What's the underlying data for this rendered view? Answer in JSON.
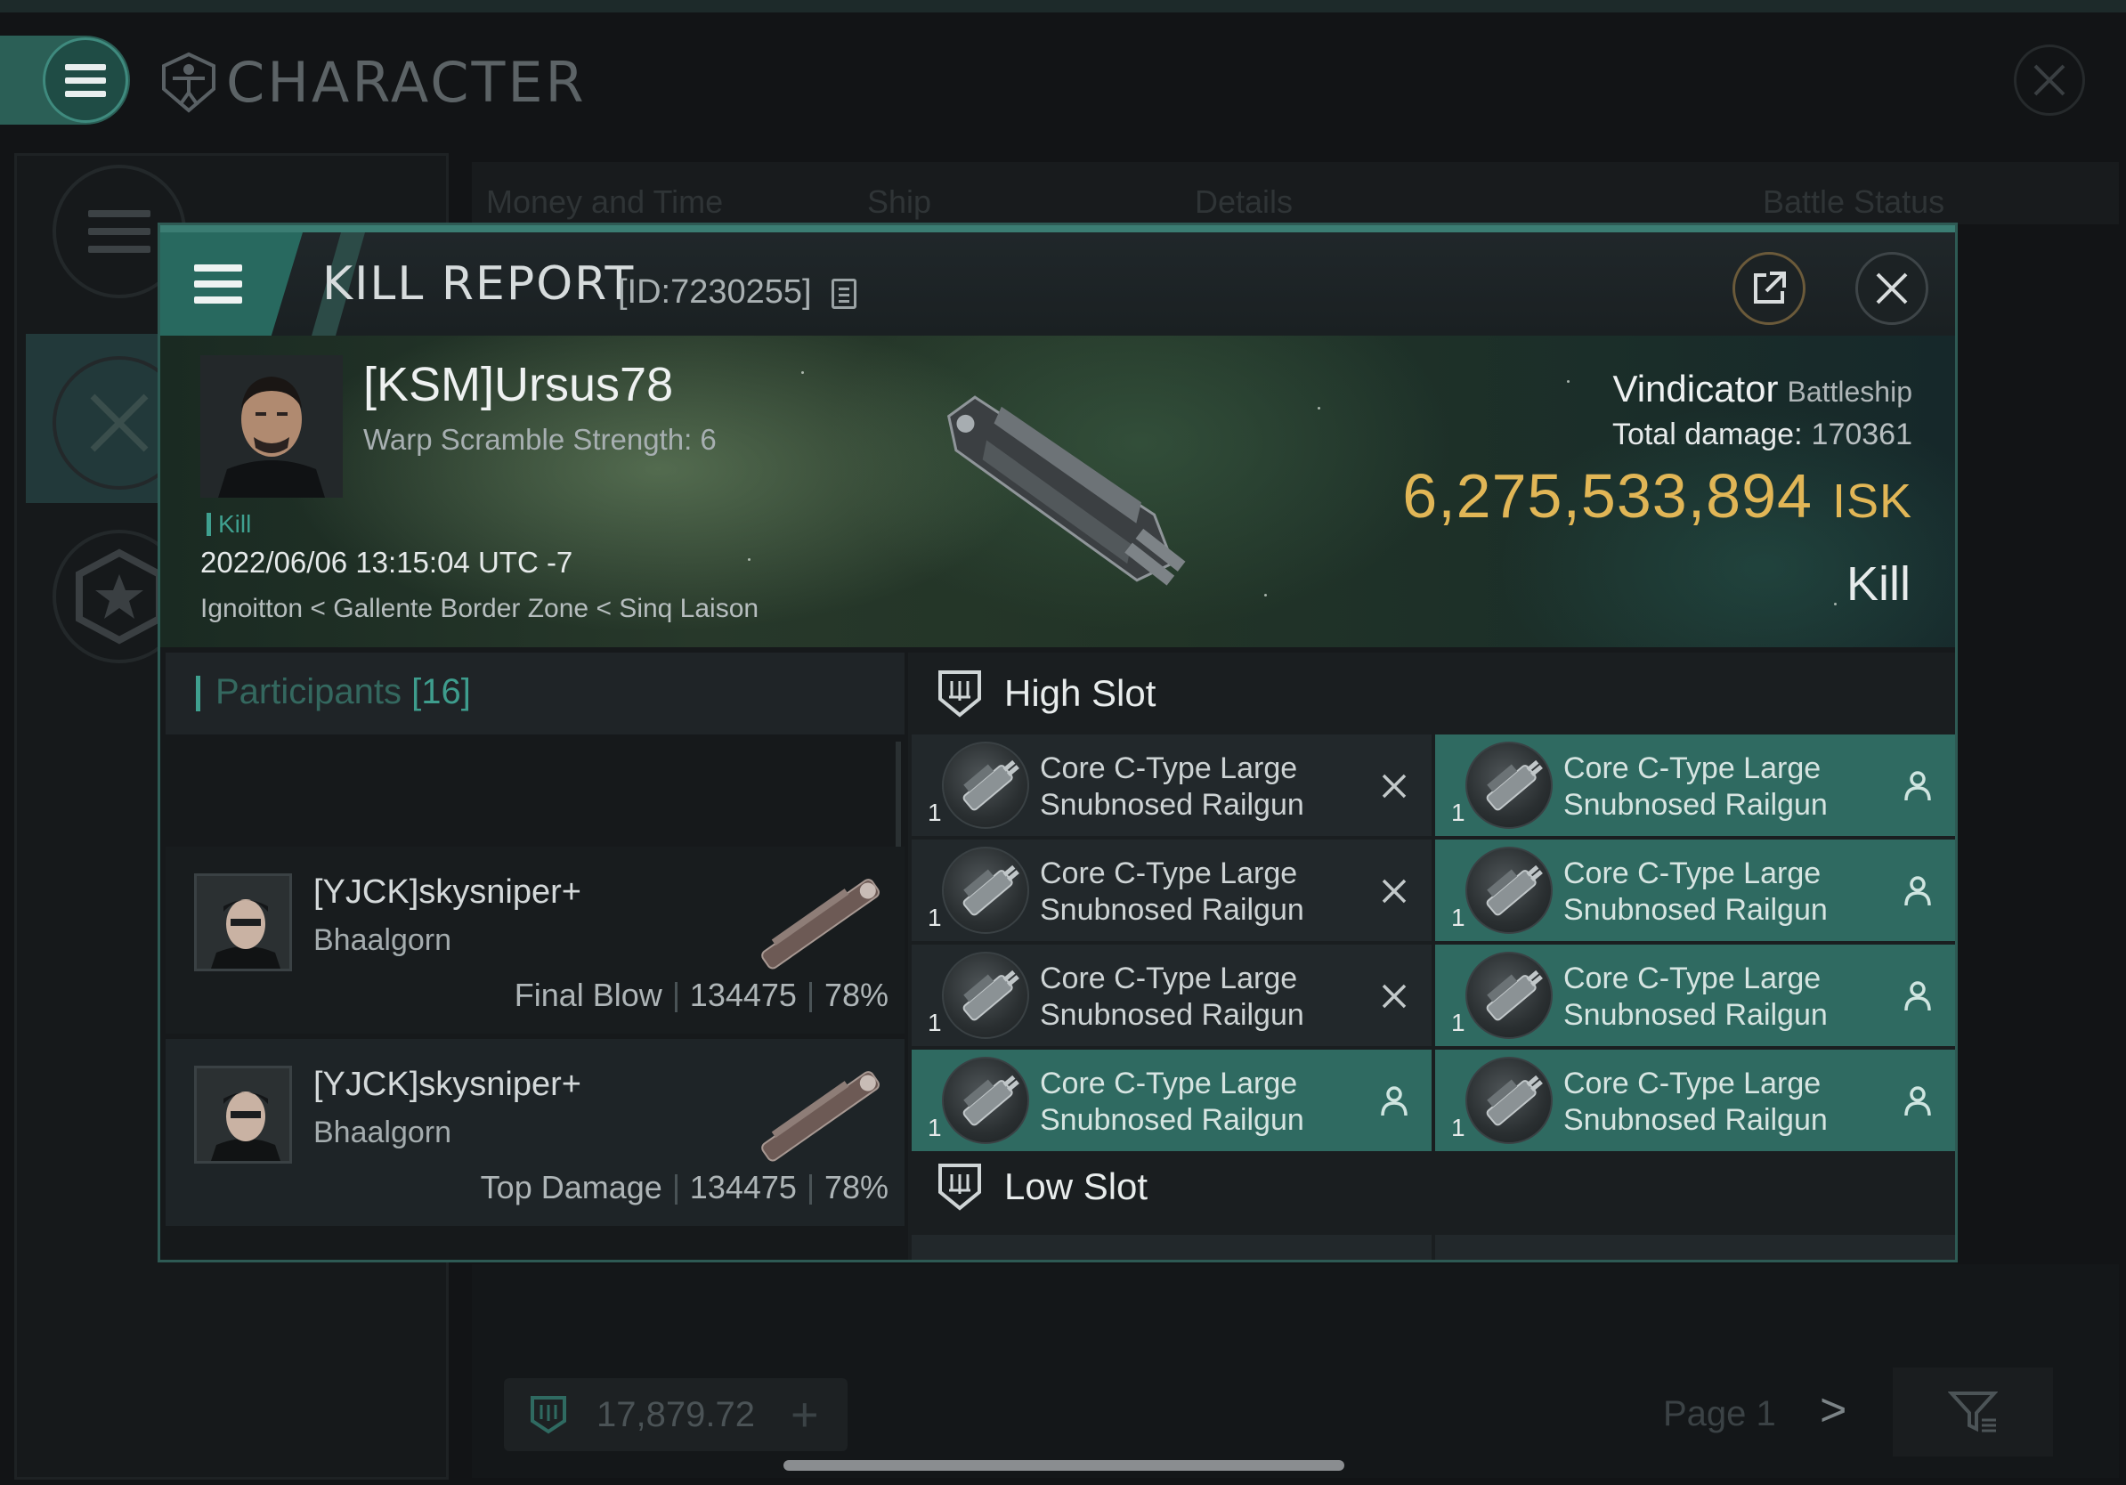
{
  "app": {
    "title": "CHARACTER",
    "background_tabs": [
      "Money and Time",
      "Ship",
      "Details",
      "Battle Status"
    ],
    "footer": {
      "balance": "17,879.72",
      "page_label": "Page 1"
    }
  },
  "kill_report": {
    "title": "KILL REPORT",
    "id_label": "[ID:7230255]",
    "victim": {
      "name": "[KSM]Ursus78",
      "subtitle": "Warp Scramble Strength: 6",
      "tag": "Kill",
      "datetime": "2022/06/06 13:15:04 UTC -7",
      "location": "Ignoitton < Gallente Border Zone < Sinq Laison"
    },
    "ship": {
      "name": "Vindicator",
      "class": "Battleship",
      "total_damage_label": "Total damage:",
      "total_damage": "170361",
      "isk_value": "6,275,533,894",
      "isk_unit": "ISK",
      "result": "Kill"
    },
    "participants": {
      "label": "Participants",
      "count": "[16]",
      "rows": [
        {
          "name": "[YJCK]skysniper+",
          "ship": "Bhaalgorn",
          "role": "Final Blow",
          "damage": "134475",
          "percent": "78%"
        },
        {
          "name": "[YJCK]skysniper+",
          "ship": "Bhaalgorn",
          "role": "Top Damage",
          "damage": "134475",
          "percent": "78%"
        }
      ]
    },
    "high_slot": {
      "label": "High Slot",
      "modules": [
        {
          "qty": "1",
          "line1": "Core C-Type Large",
          "line2": "Snubnosed Railgun",
          "state": "destroyed"
        },
        {
          "qty": "1",
          "line1": "Core C-Type Large",
          "line2": "Snubnosed Railgun",
          "state": "dropped"
        },
        {
          "qty": "1",
          "line1": "Core C-Type Large",
          "line2": "Snubnosed Railgun",
          "state": "destroyed"
        },
        {
          "qty": "1",
          "line1": "Core C-Type Large",
          "line2": "Snubnosed Railgun",
          "state": "dropped"
        },
        {
          "qty": "1",
          "line1": "Core C-Type Large",
          "line2": "Snubnosed Railgun",
          "state": "destroyed"
        },
        {
          "qty": "1",
          "line1": "Core C-Type Large",
          "line2": "Snubnosed Railgun",
          "state": "dropped"
        },
        {
          "qty": "1",
          "line1": "Core C-Type Large",
          "line2": "Snubnosed Railgun",
          "state": "dropped"
        },
        {
          "qty": "1",
          "line1": "Core C-Type Large",
          "line2": "Snubnosed Railgun",
          "state": "dropped"
        }
      ]
    },
    "low_slot": {
      "label": "Low Slot"
    }
  },
  "colors": {
    "accent_teal": "#3b7d73",
    "module_dropped_bg": "#2f6a61",
    "isk_gold": "#e1b656"
  },
  "icons": {
    "menu": "hamburger-icon",
    "character": "vitruvian-shield-icon",
    "share": "external-link-icon",
    "close": "close-icon",
    "destroyed": "x-icon",
    "dropped": "person-icon",
    "slot": "slot-shield-icon"
  }
}
